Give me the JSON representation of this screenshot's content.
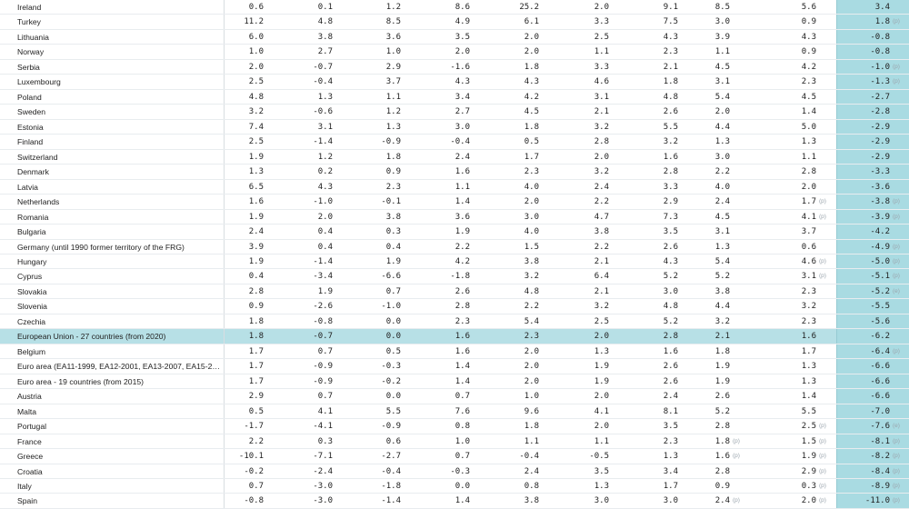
{
  "table": {
    "highlight_country": "European Union - 27 countries (from 2020)",
    "colors": {
      "highlight_row": "#b7e0e6",
      "last_column": "#a9dbe2",
      "border": "#e8ecef"
    },
    "rows": [
      {
        "country": "Ireland",
        "values": [
          "0.6",
          "0.1",
          "1.2",
          "8.6",
          "25.2",
          "2.0",
          "9.1",
          "8.5",
          "5.6",
          "3.4"
        ],
        "flags": [
          "",
          "",
          "",
          "",
          "",
          "",
          "",
          "",
          "",
          ""
        ]
      },
      {
        "country": "Turkey",
        "values": [
          "11.2",
          "4.8",
          "8.5",
          "4.9",
          "6.1",
          "3.3",
          "7.5",
          "3.0",
          "0.9",
          "1.8"
        ],
        "flags": [
          "",
          "",
          "",
          "",
          "",
          "",
          "",
          "",
          "",
          "(p)"
        ]
      },
      {
        "country": "Lithuania",
        "values": [
          "6.0",
          "3.8",
          "3.6",
          "3.5",
          "2.0",
          "2.5",
          "4.3",
          "3.9",
          "4.3",
          "-0.8"
        ],
        "flags": [
          "",
          "",
          "",
          "",
          "",
          "",
          "",
          "",
          "",
          ""
        ]
      },
      {
        "country": "Norway",
        "values": [
          "1.0",
          "2.7",
          "1.0",
          "2.0",
          "2.0",
          "1.1",
          "2.3",
          "1.1",
          "0.9",
          "-0.8"
        ],
        "flags": [
          "",
          "",
          "",
          "",
          "",
          "",
          "",
          "",
          "",
          ""
        ]
      },
      {
        "country": "Serbia",
        "values": [
          "2.0",
          "-0.7",
          "2.9",
          "-1.6",
          "1.8",
          "3.3",
          "2.1",
          "4.5",
          "4.2",
          "-1.0"
        ],
        "flags": [
          "",
          "",
          "",
          "",
          "",
          "",
          "",
          "",
          "",
          "(p)"
        ]
      },
      {
        "country": "Luxembourg",
        "values": [
          "2.5",
          "-0.4",
          "3.7",
          "4.3",
          "4.3",
          "4.6",
          "1.8",
          "3.1",
          "2.3",
          "-1.3"
        ],
        "flags": [
          "",
          "",
          "",
          "",
          "",
          "",
          "",
          "",
          "",
          "(p)"
        ]
      },
      {
        "country": "Poland",
        "values": [
          "4.8",
          "1.3",
          "1.1",
          "3.4",
          "4.2",
          "3.1",
          "4.8",
          "5.4",
          "4.5",
          "-2.7"
        ],
        "flags": [
          "",
          "",
          "",
          "",
          "",
          "",
          "",
          "",
          "",
          ""
        ]
      },
      {
        "country": "Sweden",
        "values": [
          "3.2",
          "-0.6",
          "1.2",
          "2.7",
          "4.5",
          "2.1",
          "2.6",
          "2.0",
          "1.4",
          "-2.8"
        ],
        "flags": [
          "",
          "",
          "",
          "",
          "",
          "",
          "",
          "",
          "",
          ""
        ]
      },
      {
        "country": "Estonia",
        "values": [
          "7.4",
          "3.1",
          "1.3",
          "3.0",
          "1.8",
          "3.2",
          "5.5",
          "4.4",
          "5.0",
          "-2.9"
        ],
        "flags": [
          "",
          "",
          "",
          "",
          "",
          "",
          "",
          "",
          "",
          ""
        ]
      },
      {
        "country": "Finland",
        "values": [
          "2.5",
          "-1.4",
          "-0.9",
          "-0.4",
          "0.5",
          "2.8",
          "3.2",
          "1.3",
          "1.3",
          "-2.9"
        ],
        "flags": [
          "",
          "",
          "",
          "",
          "",
          "",
          "",
          "",
          "",
          ""
        ]
      },
      {
        "country": "Switzerland",
        "values": [
          "1.9",
          "1.2",
          "1.8",
          "2.4",
          "1.7",
          "2.0",
          "1.6",
          "3.0",
          "1.1",
          "-2.9"
        ],
        "flags": [
          "",
          "",
          "",
          "",
          "",
          "",
          "",
          "",
          "",
          ""
        ]
      },
      {
        "country": "Denmark",
        "values": [
          "1.3",
          "0.2",
          "0.9",
          "1.6",
          "2.3",
          "3.2",
          "2.8",
          "2.2",
          "2.8",
          "-3.3"
        ],
        "flags": [
          "",
          "",
          "",
          "",
          "",
          "",
          "",
          "",
          "",
          ""
        ]
      },
      {
        "country": "Latvia",
        "values": [
          "6.5",
          "4.3",
          "2.3",
          "1.1",
          "4.0",
          "2.4",
          "3.3",
          "4.0",
          "2.0",
          "-3.6"
        ],
        "flags": [
          "",
          "",
          "",
          "",
          "",
          "",
          "",
          "",
          "",
          ""
        ]
      },
      {
        "country": "Netherlands",
        "values": [
          "1.6",
          "-1.0",
          "-0.1",
          "1.4",
          "2.0",
          "2.2",
          "2.9",
          "2.4",
          "1.7",
          "-3.8"
        ],
        "flags": [
          "",
          "",
          "",
          "",
          "",
          "",
          "",
          "",
          "(p)",
          "(p)"
        ]
      },
      {
        "country": "Romania",
        "values": [
          "1.9",
          "2.0",
          "3.8",
          "3.6",
          "3.0",
          "4.7",
          "7.3",
          "4.5",
          "4.1",
          "-3.9"
        ],
        "flags": [
          "",
          "",
          "",
          "",
          "",
          "",
          "",
          "",
          "(p)",
          "(p)"
        ]
      },
      {
        "country": "Bulgaria",
        "values": [
          "2.4",
          "0.4",
          "0.3",
          "1.9",
          "4.0",
          "3.8",
          "3.5",
          "3.1",
          "3.7",
          "-4.2"
        ],
        "flags": [
          "",
          "",
          "",
          "",
          "",
          "",
          "",
          "",
          "",
          ""
        ]
      },
      {
        "country": "Germany (until 1990 former territory of the FRG)",
        "values": [
          "3.9",
          "0.4",
          "0.4",
          "2.2",
          "1.5",
          "2.2",
          "2.6",
          "1.3",
          "0.6",
          "-4.9"
        ],
        "flags": [
          "",
          "",
          "",
          "",
          "",
          "",
          "",
          "",
          "",
          "(p)"
        ]
      },
      {
        "country": "Hungary",
        "values": [
          "1.9",
          "-1.4",
          "1.9",
          "4.2",
          "3.8",
          "2.1",
          "4.3",
          "5.4",
          "4.6",
          "-5.0"
        ],
        "flags": [
          "",
          "",
          "",
          "",
          "",
          "",
          "",
          "",
          "(p)",
          "(p)"
        ]
      },
      {
        "country": "Cyprus",
        "values": [
          "0.4",
          "-3.4",
          "-6.6",
          "-1.8",
          "3.2",
          "6.4",
          "5.2",
          "5.2",
          "3.1",
          "-5.1"
        ],
        "flags": [
          "",
          "",
          "",
          "",
          "",
          "",
          "",
          "",
          "(p)",
          "(p)"
        ]
      },
      {
        "country": "Slovakia",
        "values": [
          "2.8",
          "1.9",
          "0.7",
          "2.6",
          "4.8",
          "2.1",
          "3.0",
          "3.8",
          "2.3",
          "-5.2"
        ],
        "flags": [
          "",
          "",
          "",
          "",
          "",
          "",
          "",
          "",
          "",
          "(e)"
        ]
      },
      {
        "country": "Slovenia",
        "values": [
          "0.9",
          "-2.6",
          "-1.0",
          "2.8",
          "2.2",
          "3.2",
          "4.8",
          "4.4",
          "3.2",
          "-5.5"
        ],
        "flags": [
          "",
          "",
          "",
          "",
          "",
          "",
          "",
          "",
          "",
          ""
        ]
      },
      {
        "country": "Czechia",
        "values": [
          "1.8",
          "-0.8",
          "0.0",
          "2.3",
          "5.4",
          "2.5",
          "5.2",
          "3.2",
          "2.3",
          "-5.6"
        ],
        "flags": [
          "",
          "",
          "",
          "",
          "",
          "",
          "",
          "",
          "",
          ""
        ]
      },
      {
        "country": "European Union - 27 countries (from 2020)",
        "values": [
          "1.8",
          "-0.7",
          "0.0",
          "1.6",
          "2.3",
          "2.0",
          "2.8",
          "2.1",
          "1.6",
          "-6.2"
        ],
        "flags": [
          "",
          "",
          "",
          "",
          "",
          "",
          "",
          "",
          "",
          ""
        ]
      },
      {
        "country": "Belgium",
        "values": [
          "1.7",
          "0.7",
          "0.5",
          "1.6",
          "2.0",
          "1.3",
          "1.6",
          "1.8",
          "1.7",
          "-6.4"
        ],
        "flags": [
          "",
          "",
          "",
          "",
          "",
          "",
          "",
          "",
          "",
          "(p)"
        ]
      },
      {
        "country": "Euro area (EA11-1999, EA12-2001, EA13-2007, EA15-2…",
        "values": [
          "1.7",
          "-0.9",
          "-0.3",
          "1.4",
          "2.0",
          "1.9",
          "2.6",
          "1.9",
          "1.3",
          "-6.6"
        ],
        "flags": [
          "",
          "",
          "",
          "",
          "",
          "",
          "",
          "",
          "",
          ""
        ]
      },
      {
        "country": "Euro area - 19 countries (from 2015)",
        "values": [
          "1.7",
          "-0.9",
          "-0.2",
          "1.4",
          "2.0",
          "1.9",
          "2.6",
          "1.9",
          "1.3",
          "-6.6"
        ],
        "flags": [
          "",
          "",
          "",
          "",
          "",
          "",
          "",
          "",
          "",
          ""
        ]
      },
      {
        "country": "Austria",
        "values": [
          "2.9",
          "0.7",
          "0.0",
          "0.7",
          "1.0",
          "2.0",
          "2.4",
          "2.6",
          "1.4",
          "-6.6"
        ],
        "flags": [
          "",
          "",
          "",
          "",
          "",
          "",
          "",
          "",
          "",
          ""
        ]
      },
      {
        "country": "Malta",
        "values": [
          "0.5",
          "4.1",
          "5.5",
          "7.6",
          "9.6",
          "4.1",
          "8.1",
          "5.2",
          "5.5",
          "-7.0"
        ],
        "flags": [
          "",
          "",
          "",
          "",
          "",
          "",
          "",
          "",
          "",
          ""
        ]
      },
      {
        "country": "Portugal",
        "values": [
          "-1.7",
          "-4.1",
          "-0.9",
          "0.8",
          "1.8",
          "2.0",
          "3.5",
          "2.8",
          "2.5",
          "-7.6"
        ],
        "flags": [
          "",
          "",
          "",
          "",
          "",
          "",
          "",
          "",
          "(p)",
          "(e)"
        ]
      },
      {
        "country": "France",
        "values": [
          "2.2",
          "0.3",
          "0.6",
          "1.0",
          "1.1",
          "1.1",
          "2.3",
          "1.8",
          "1.5",
          "-8.1"
        ],
        "flags": [
          "",
          "",
          "",
          "",
          "",
          "",
          "",
          "(p)",
          "(p)",
          "(p)"
        ]
      },
      {
        "country": "Greece",
        "values": [
          "-10.1",
          "-7.1",
          "-2.7",
          "0.7",
          "-0.4",
          "-0.5",
          "1.3",
          "1.6",
          "1.9",
          "-8.2"
        ],
        "flags": [
          "",
          "",
          "",
          "",
          "",
          "",
          "",
          "(p)",
          "(p)",
          "(p)"
        ]
      },
      {
        "country": "Croatia",
        "values": [
          "-0.2",
          "-2.4",
          "-0.4",
          "-0.3",
          "2.4",
          "3.5",
          "3.4",
          "2.8",
          "2.9",
          "-8.4"
        ],
        "flags": [
          "",
          "",
          "",
          "",
          "",
          "",
          "",
          "",
          "(p)",
          "(p)"
        ]
      },
      {
        "country": "Italy",
        "values": [
          "0.7",
          "-3.0",
          "-1.8",
          "0.0",
          "0.8",
          "1.3",
          "1.7",
          "0.9",
          "0.3",
          "-8.9"
        ],
        "flags": [
          "",
          "",
          "",
          "",
          "",
          "",
          "",
          "",
          "(p)",
          "(p)"
        ]
      },
      {
        "country": "Spain",
        "values": [
          "-0.8",
          "-3.0",
          "-1.4",
          "1.4",
          "3.8",
          "3.0",
          "3.0",
          "2.4",
          "2.0",
          "-11.0"
        ],
        "flags": [
          "",
          "",
          "",
          "",
          "",
          "",
          "",
          "(p)",
          "(p)",
          "(p)"
        ]
      }
    ]
  }
}
